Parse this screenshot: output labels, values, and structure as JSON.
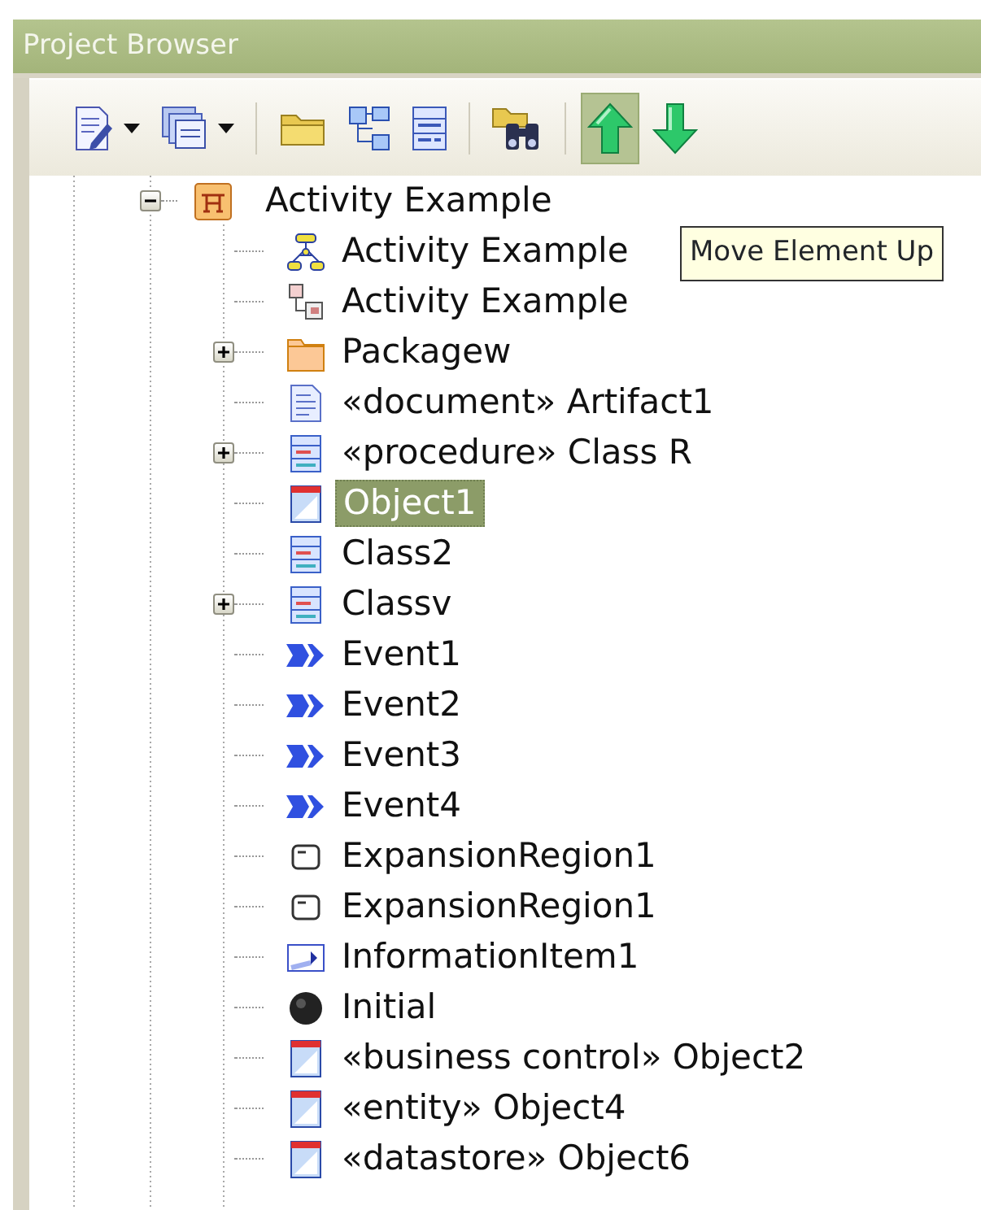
{
  "panel": {
    "title": "Project Browser"
  },
  "toolbar": [
    {
      "kind": "edit",
      "dropdown": true,
      "pressed": false
    },
    {
      "kind": "copy",
      "dropdown": true,
      "pressed": false
    },
    {
      "kind": "separator"
    },
    {
      "kind": "folder",
      "dropdown": false,
      "pressed": false
    },
    {
      "kind": "tree",
      "dropdown": false,
      "pressed": false
    },
    {
      "kind": "class",
      "dropdown": false,
      "pressed": false
    },
    {
      "kind": "separator"
    },
    {
      "kind": "find",
      "dropdown": false,
      "pressed": false
    },
    {
      "kind": "separator"
    },
    {
      "kind": "up",
      "dropdown": false,
      "pressed": true
    },
    {
      "kind": "down",
      "dropdown": false,
      "pressed": false
    }
  ],
  "tree": [
    {
      "label": "Activity Example",
      "kind": "activity",
      "expandable": true,
      "expanded": true,
      "selected": false,
      "children": [
        {
          "label": "Activity Example",
          "kind": "activity-diagram",
          "expandable": false,
          "selected": false
        },
        {
          "label": "Activity Example",
          "kind": "composite-diagram",
          "expandable": false,
          "selected": false
        },
        {
          "label": "Packagew",
          "kind": "package",
          "expandable": true,
          "expanded": false,
          "selected": false
        },
        {
          "label": "«document» Artifact1",
          "kind": "artifact",
          "expandable": false,
          "selected": false
        },
        {
          "label": "«procedure» Class R",
          "kind": "class",
          "expandable": true,
          "expanded": false,
          "selected": false
        },
        {
          "label": "Object1",
          "kind": "object",
          "expandable": false,
          "selected": true
        },
        {
          "label": "Class2",
          "kind": "class",
          "expandable": false,
          "selected": false
        },
        {
          "label": "Classv",
          "kind": "class",
          "expandable": true,
          "expanded": false,
          "selected": false
        },
        {
          "label": "Event1",
          "kind": "event",
          "expandable": false,
          "selected": false
        },
        {
          "label": "Event2",
          "kind": "event",
          "expandable": false,
          "selected": false
        },
        {
          "label": "Event3",
          "kind": "event",
          "expandable": false,
          "selected": false
        },
        {
          "label": "Event4",
          "kind": "event",
          "expandable": false,
          "selected": false
        },
        {
          "label": "ExpansionRegion1",
          "kind": "expansion",
          "expandable": false,
          "selected": false
        },
        {
          "label": "ExpansionRegion1",
          "kind": "expansion",
          "expandable": false,
          "selected": false
        },
        {
          "label": "InformationItem1",
          "kind": "information",
          "expandable": false,
          "selected": false
        },
        {
          "label": "Initial",
          "kind": "initial",
          "expandable": false,
          "selected": false
        },
        {
          "label": "«business control» Object2",
          "kind": "object",
          "expandable": false,
          "selected": false
        },
        {
          "label": "«entity» Object4",
          "kind": "object",
          "expandable": false,
          "selected": false
        },
        {
          "label": "«datastore» Object6",
          "kind": "object",
          "expandable": false,
          "selected": false
        }
      ]
    }
  ],
  "tooltip": {
    "text": "Move Element Up"
  }
}
